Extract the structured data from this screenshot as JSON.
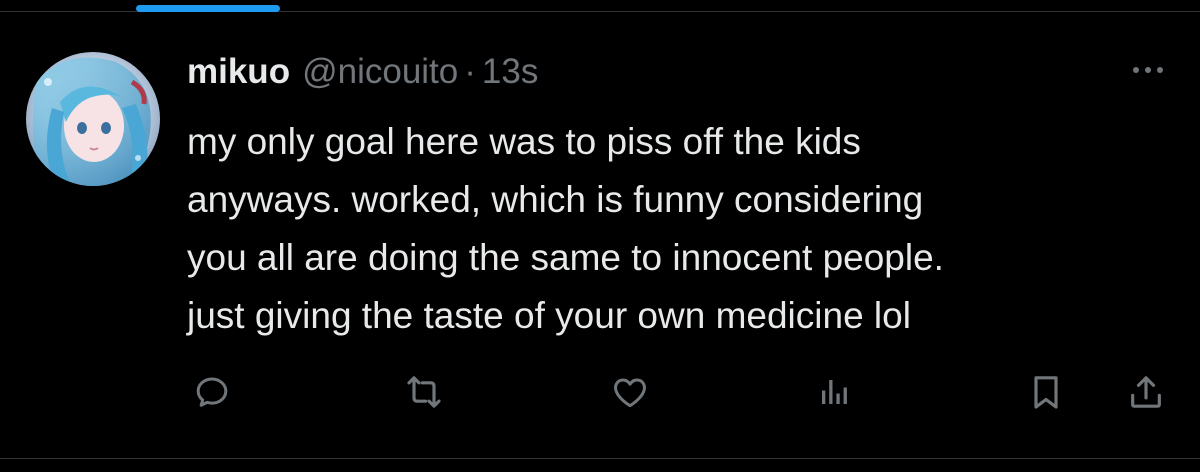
{
  "tweet": {
    "display_name": "mikuo",
    "handle": "@nicouito",
    "separator": "·",
    "timestamp": "13s",
    "text_lines": [
      "my only goal here was to piss off the kids",
      "anyways. worked, which is funny considering",
      "you all are doing the same to innocent people.",
      "just giving the taste of your own medicine lol"
    ]
  },
  "actions": [
    {
      "name": "reply",
      "icon": "reply-icon"
    },
    {
      "name": "retweet",
      "icon": "retweet-icon"
    },
    {
      "name": "like",
      "icon": "heart-icon"
    },
    {
      "name": "views",
      "icon": "views-icon"
    },
    {
      "name": "bookmark",
      "icon": "bookmark-icon"
    },
    {
      "name": "share",
      "icon": "share-icon"
    }
  ],
  "colors": {
    "background": "#000000",
    "primary_text": "#e7e9ea",
    "secondary_text": "#71767b",
    "accent": "#1d9bf0",
    "divider": "#2f3336"
  }
}
